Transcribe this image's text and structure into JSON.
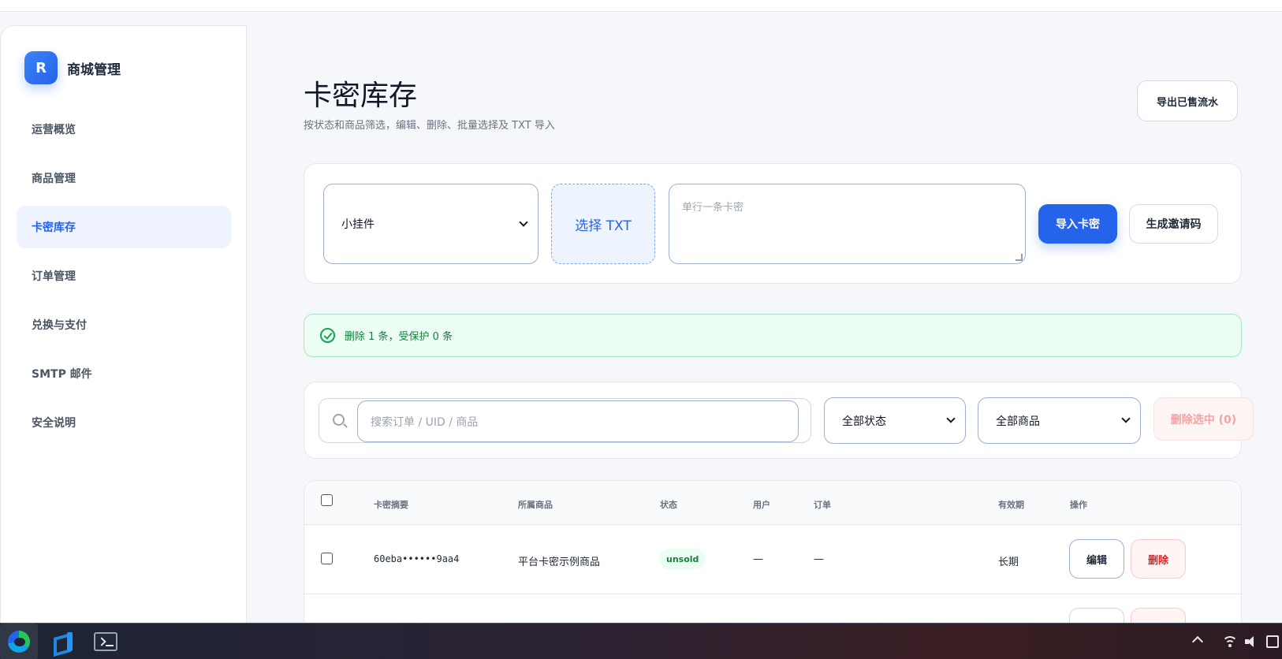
{
  "brand": {
    "logo_letter": "R",
    "name": "商城管理"
  },
  "sidebar": {
    "items": [
      {
        "label": "运营概览",
        "active": false
      },
      {
        "label": "商品管理",
        "active": false
      },
      {
        "label": "卡密库存",
        "active": true
      },
      {
        "label": "订单管理",
        "active": false
      },
      {
        "label": "兑换与支付",
        "active": false
      },
      {
        "label": "SMTP 邮件",
        "active": false
      },
      {
        "label": "安全说明",
        "active": false
      }
    ]
  },
  "header": {
    "title": "卡密库存",
    "subtitle": "按状态和商品筛选，编辑、删除、批量选择及 TXT 导入",
    "export_label": "导出已售流水"
  },
  "import": {
    "product_selected": "小挂件",
    "choose_txt_label": "选择 TXT",
    "textarea_placeholder": "单行一条卡密",
    "import_label": "导入卡密",
    "invite_label": "生成邀请码"
  },
  "alert": {
    "message": "删除 1 条，受保护 0 条",
    "color": "#15803d"
  },
  "filters": {
    "search_placeholder": "搜索订单 / UID / 商品",
    "status_selected": "全部状态",
    "goods_selected": "全部商品",
    "delete_selected_label": "删除选中 (0)"
  },
  "table": {
    "headers": [
      "卡密摘要",
      "所属商品",
      "状态",
      "用户",
      "订单",
      "有效期",
      "操作"
    ],
    "rows": [
      {
        "code": "60eba••••••9aa4",
        "product": "平台卡密示例商品",
        "status": "unsold",
        "user": "—",
        "order": "—",
        "validity": "长期",
        "edit_label": "编辑",
        "delete_label": "删除"
      }
    ]
  },
  "colors": {
    "accent": "#2563eb",
    "danger": "#dc2626",
    "success": "#16a34a"
  },
  "taskbar": {
    "apps": [
      "edge-icon",
      "vscode-icon",
      "terminal-icon"
    ]
  }
}
